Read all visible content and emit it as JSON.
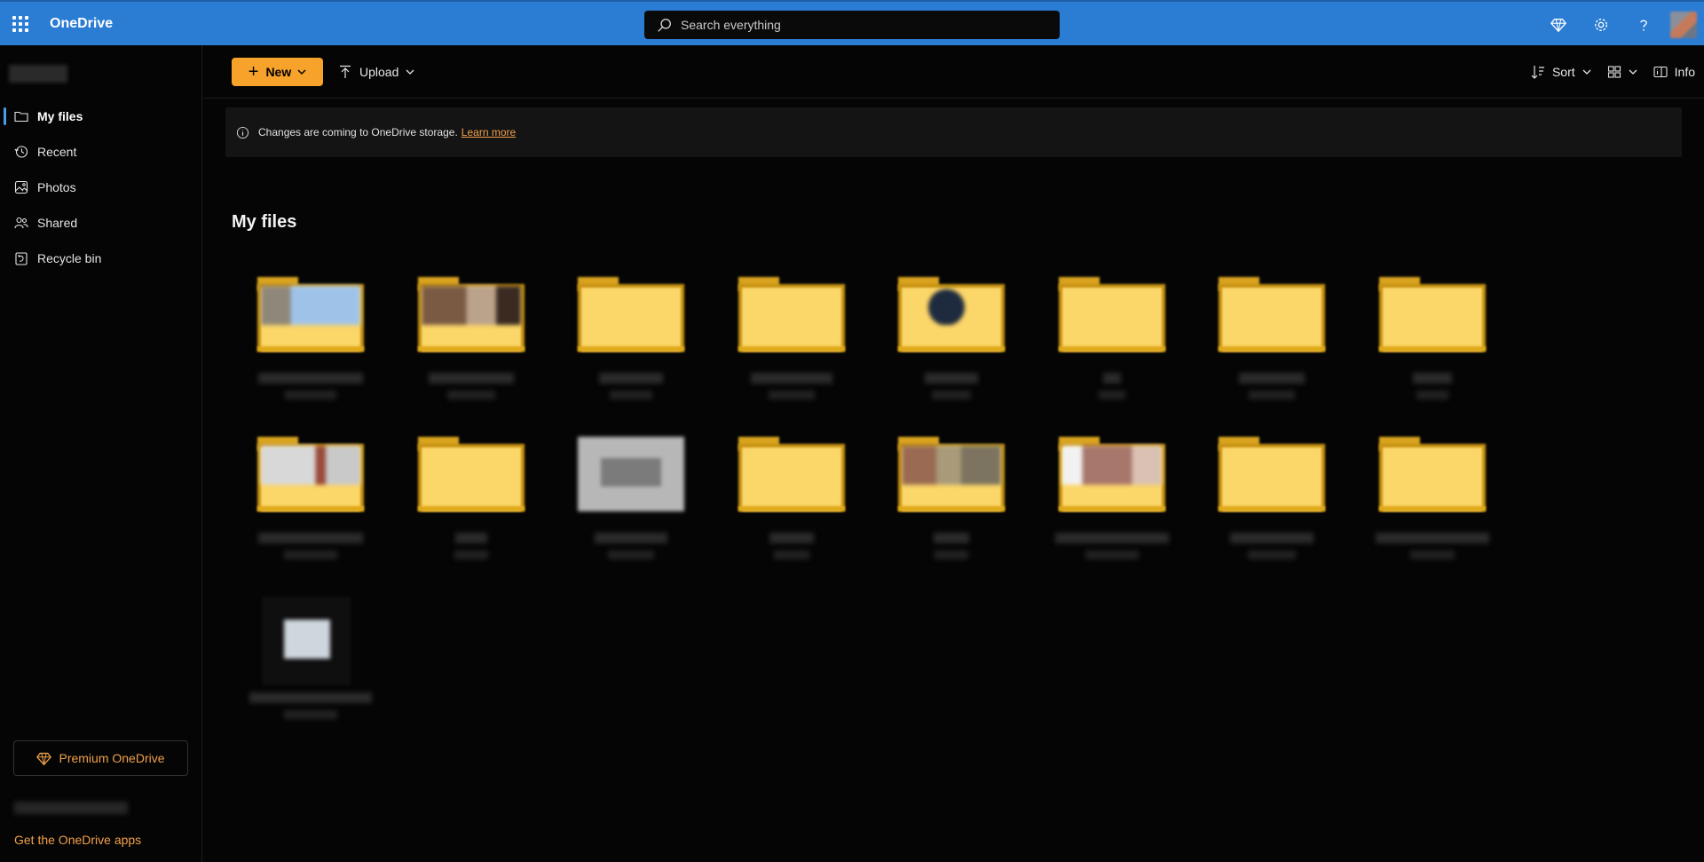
{
  "app": {
    "name": "OneDrive"
  },
  "search": {
    "placeholder": "Search everything"
  },
  "sidebar": {
    "items": [
      {
        "label": "My files",
        "icon": "folder-icon",
        "active": true
      },
      {
        "label": "Recent",
        "icon": "clock-icon",
        "active": false
      },
      {
        "label": "Photos",
        "icon": "photo-icon",
        "active": false
      },
      {
        "label": "Shared",
        "icon": "people-icon",
        "active": false
      },
      {
        "label": "Recycle bin",
        "icon": "trash-icon",
        "active": false
      }
    ],
    "premium_label": "Premium OneDrive",
    "get_apps_label": "Get the OneDrive apps"
  },
  "toolbar": {
    "new_label": "New",
    "upload_label": "Upload",
    "sort_label": "Sort",
    "info_label": "Info"
  },
  "banner": {
    "message": "Changes are coming to OneDrive storage.",
    "link_label": "Learn more"
  },
  "main": {
    "title": "My files"
  },
  "colors": {
    "topbar": "#2b7cd3",
    "accent": "#f7a22b",
    "link": "#f0a04a",
    "background": "#050505",
    "folder": "#fbd669"
  },
  "files": [
    {
      "kind": "folder",
      "thumb": "sky"
    },
    {
      "kind": "folder",
      "thumb": "brown"
    },
    {
      "kind": "folder",
      "thumb": "none"
    },
    {
      "kind": "folder",
      "thumb": "none"
    },
    {
      "kind": "folder",
      "thumb": "dark"
    },
    {
      "kind": "folder",
      "thumb": "none"
    },
    {
      "kind": "folder",
      "thumb": "none"
    },
    {
      "kind": "folder",
      "thumb": "none"
    },
    {
      "kind": "folder",
      "thumb": "light"
    },
    {
      "kind": "folder",
      "thumb": "none"
    },
    {
      "kind": "file",
      "thumb": "gray"
    },
    {
      "kind": "folder",
      "thumb": "none"
    },
    {
      "kind": "folder",
      "thumb": "mixed"
    },
    {
      "kind": "folder",
      "thumb": "pinkish"
    },
    {
      "kind": "folder",
      "thumb": "none"
    },
    {
      "kind": "folder",
      "thumb": "none"
    },
    {
      "kind": "image",
      "thumb": "screen"
    }
  ]
}
